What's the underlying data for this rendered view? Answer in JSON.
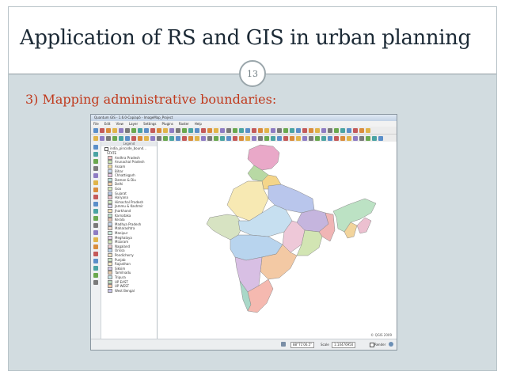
{
  "slide": {
    "title": "Application of RS and GIS in urban planning",
    "page_number": "13",
    "subtitle": "3)  Mapping administrative boundaries:"
  },
  "app": {
    "window_title": "Quantum GIS - 1.6.0-Capiapó - ImageMap_Project",
    "menu": [
      "File",
      "Edit",
      "View",
      "Layer",
      "Settings",
      "Plugins",
      "Raster",
      "Help"
    ],
    "legend_header": "Legend",
    "layer_name": "india_pincode_bound...",
    "layer_field": "STATE",
    "states": [
      "Andhra Pradesh",
      "Arunachal Pradesh",
      "Assam",
      "Bihar",
      "Chhattisgarh",
      "Daman & Diu",
      "Delhi",
      "Goa",
      "Gujarat",
      "Haryana",
      "Himachal Pradesh",
      "Jammu & Kashmir",
      "Jharkhand",
      "Karnataka",
      "Kerala",
      "Madhya Pradesh",
      "Maharashtra",
      "Manipur",
      "Meghalaya",
      "Mizoram",
      "Nagaland",
      "Orissa",
      "Pondicherry",
      "Punjab",
      "Rajasthan",
      "Sikkim",
      "Tamilnadu",
      "Tripura",
      "UP EAST",
      "UP WEST",
      "West Bengal"
    ],
    "state_colors": [
      "#f4c2c2",
      "#c9e3b0",
      "#f6e3a5",
      "#c7d9f0",
      "#e8c6e2",
      "#b9e2de",
      "#f2d0a8",
      "#d6eabf",
      "#b5c9ea",
      "#ecc1cb",
      "#cfe8c0",
      "#d8d4ef",
      "#f3e0b6",
      "#bfe3cf",
      "#e9c7b4",
      "#c4d6ee",
      "#efd7c9",
      "#c8e9dc",
      "#e6d2e8",
      "#d0e4b8",
      "#f0cfd3",
      "#bcd7f2",
      "#eedfc0",
      "#c9e7c8",
      "#f6eac1",
      "#d4cbe9",
      "#e5c8a8",
      "#c6e4e8",
      "#b7d7b9",
      "#f2c7a6",
      "#c7c3e8"
    ],
    "copyright": "© QGIS 2009",
    "status_coordinate": "88°71'06.5\"",
    "status_scale_label": "Scale",
    "status_scale_value": "1:10476950",
    "status_render_label": "Render"
  }
}
